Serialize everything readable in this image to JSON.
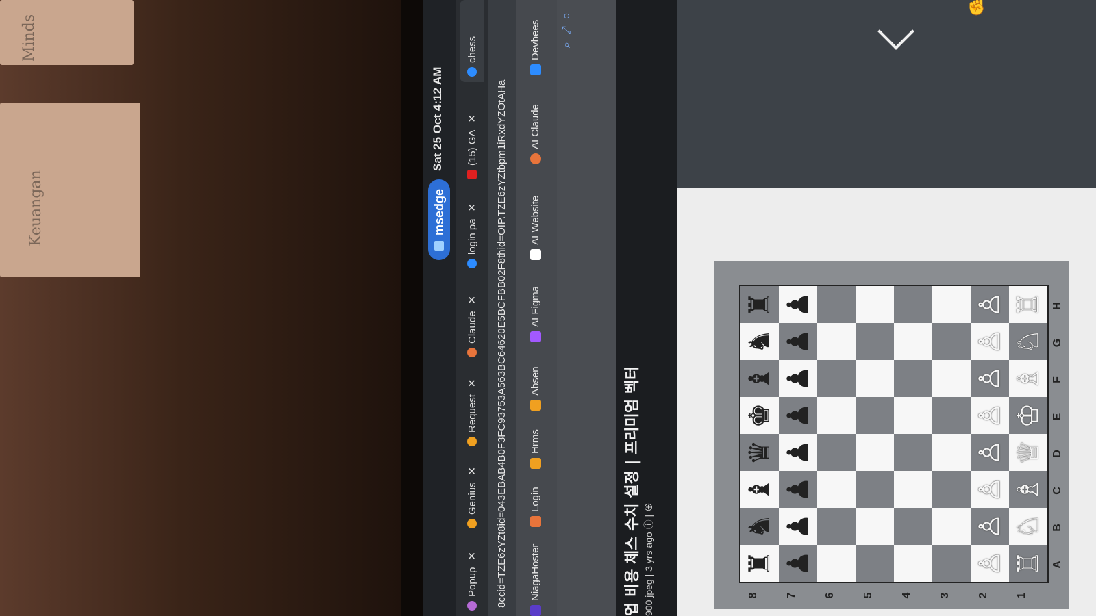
{
  "photo": {
    "sticky_note_1": "Minds",
    "sticky_note_2": "Keuangan"
  },
  "system_bar": {
    "app_label": "msedge",
    "datetime": "Sat 25 Oct 4:12 AM"
  },
  "tabs": [
    {
      "label": "Popup",
      "color": "#b66bd6"
    },
    {
      "label": "Genius",
      "color": "#f0a020"
    },
    {
      "label": "Request",
      "color": "#f0a020"
    },
    {
      "label": "Claude",
      "color": "#e8743b"
    },
    {
      "label": "login pa",
      "color": "#2d8cff"
    },
    {
      "label": "(15) GA",
      "color": "#e02020"
    },
    {
      "label": "chess",
      "color": "#2d8cff"
    }
  ],
  "url": "8ccid=TZE6zYZt8id=043EBAB4B0F3FC93753A563BC64620E5BCFBB02F8thid=OIP.TZE6zYZtbpm1iRxdYZOtAHa",
  "bookmarks": [
    {
      "label": "NiagaHoster",
      "color": "#5a3cc8"
    },
    {
      "label": "Login",
      "color": "#e8743b"
    },
    {
      "label": "Hrms",
      "color": "#f0a020"
    },
    {
      "label": "Absen",
      "color": "#f0a020"
    },
    {
      "label": "AI Figma",
      "color": "#a259ff"
    },
    {
      "label": "AI Website",
      "color": "#ffffff"
    },
    {
      "label": "AI Claude",
      "color": "#e8743b"
    },
    {
      "label": "Devbees",
      "color": "#2d8cff"
    }
  ],
  "page": {
    "title": "업 비용 체스 수치 설정 | 프리미엄 벡터",
    "meta": "900 jpeg | 3 yrs ago"
  },
  "board": {
    "ranks": [
      "8",
      "7",
      "6",
      "5",
      "4",
      "3",
      "2",
      "1"
    ],
    "files": [
      "A",
      "B",
      "C",
      "D",
      "E",
      "F",
      "G",
      "H"
    ],
    "rows": [
      [
        "♜",
        "♞",
        "♝",
        "♛",
        "♚",
        "♝",
        "♞",
        "♜"
      ],
      [
        "♟",
        "♟",
        "♟",
        "♟",
        "♟",
        "♟",
        "♟",
        "♟"
      ],
      [
        "",
        "",
        "",
        "",
        "",
        "",
        "",
        ""
      ],
      [
        "",
        "",
        "",
        "",
        "",
        "",
        "",
        ""
      ],
      [
        "",
        "",
        "",
        "",
        "",
        "",
        "",
        ""
      ],
      [
        "",
        "",
        "",
        "",
        "",
        "",
        "",
        ""
      ],
      [
        "♙",
        "♙",
        "♙",
        "♙",
        "♙",
        "♙",
        "♙",
        "♙"
      ],
      [
        "♖",
        "♘",
        "♗",
        "♕",
        "♔",
        "♗",
        "♘",
        "♖"
      ]
    ]
  }
}
